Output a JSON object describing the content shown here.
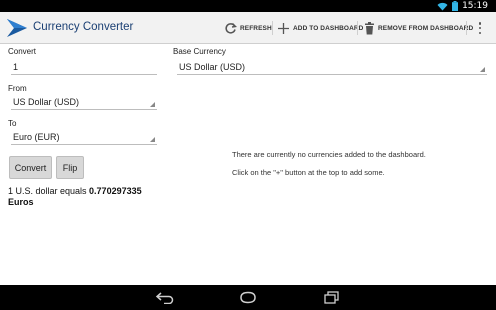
{
  "status": {
    "time": "15:19"
  },
  "actionbar": {
    "title": "Currency Converter",
    "refresh_label": "REFRESH",
    "add_label": "ADD TO DASHBOARD",
    "remove_label": "REMOVE FROM DASHBOARD"
  },
  "form": {
    "convert_label": "Convert",
    "convert_value": "1",
    "from_label": "From",
    "from_value": "US Dollar (USD)",
    "to_label": "To",
    "to_value": "Euro (EUR)",
    "convert_button": "Convert",
    "flip_button": "Flip",
    "result_prefix": "1 U.S. dollar equals ",
    "result_amount": "0.770297335",
    "result_unit": "Euros"
  },
  "dashboard": {
    "base_label": "Base Currency",
    "base_value": "US Dollar (USD)",
    "empty_line1": "There are currently no currencies added to the dashboard.",
    "empty_line2": "Click on the \"+\" button at the top to add some."
  },
  "colors": {
    "title": "#1a3f73",
    "accent": "#33b5e5"
  },
  "icons": [
    "app-logo-icon",
    "refresh-icon",
    "add-icon",
    "trash-icon",
    "overflow-menu-icon",
    "wifi-icon",
    "battery-icon",
    "back-icon",
    "home-icon",
    "recent-apps-icon"
  ]
}
